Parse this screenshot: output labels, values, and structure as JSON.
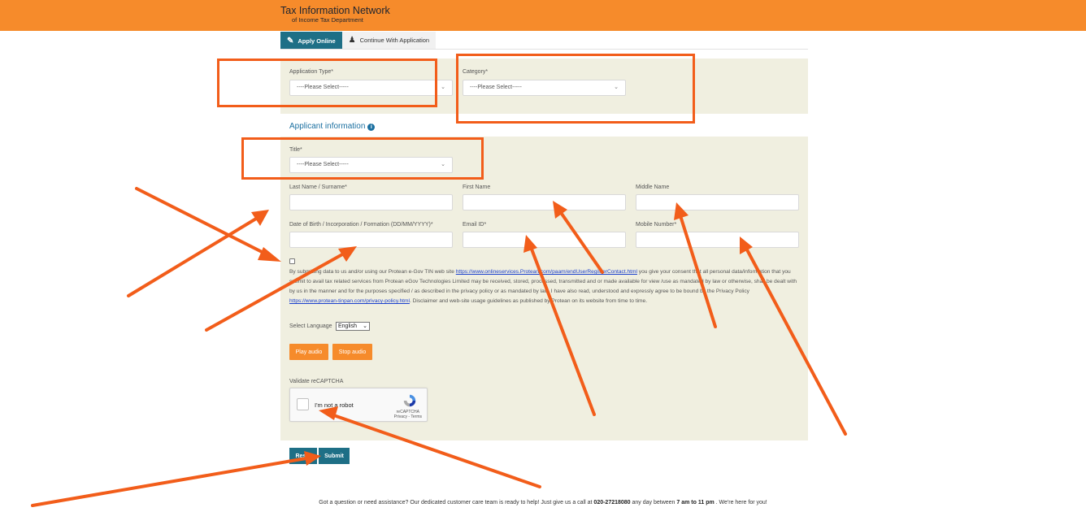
{
  "header": {
    "title": "Tax Information Network",
    "subtitle": "of Income Tax Department",
    "bg_color": "#f68b2b"
  },
  "tabs": [
    {
      "label": "Apply Online",
      "icon": "user-edit-icon",
      "active": true
    },
    {
      "label": "Continue With Application",
      "icon": "users-icon",
      "active": false
    }
  ],
  "application": {
    "type_label": "Application Type*",
    "type_value": "----Please Select-----",
    "category_label": "Category*",
    "category_value": "----Please Select-----"
  },
  "applicant": {
    "section_title": "Applicant information",
    "title_label": "Title*",
    "title_value": "----Please Select-----",
    "last_name_label": "Last Name / Surname*",
    "first_name_label": "First Name",
    "middle_name_label": "Middle Name",
    "dob_label": "Date of Birth / Incorporation / Formation (DD/MM/YYYY)*",
    "email_label": "Email ID*",
    "mobile_label": "Mobile Number*"
  },
  "consent": {
    "part1": "By submitting data to us and/or using our Protean e-Gov TIN web site ",
    "link1": "https://www.onlineservices.Protean.com/paam/endUserRegisterContact.html",
    "part2": " you give your consent that all personal data/information that you submit to avail tax related services from Protean eGov Technologies Limited may be received, stored, processed, transmitted and or made available for view /use as mandated by law or otherwise, shall be dealt with by us in the manner and for the purposes specified / as described in the privacy policy or as mandated by law. I have also read, understood and expressly agree to be bound by the Privacy Policy ",
    "link2": "https://www.protean-tinpan.com/privacy-policy.html",
    "part3": ". Disclaimer and web-site usage guidelines as published by Protean on its website from time to time."
  },
  "language": {
    "label": "Select Language",
    "selected": "English"
  },
  "audio": {
    "play_label": "Play audio",
    "stop_label": "Stop audio"
  },
  "captcha": {
    "label": "Validate reCAPTCHA",
    "text": "I'm not a robot",
    "brand": "reCAPTCHA",
    "links": "Privacy - Terms"
  },
  "actions": {
    "reset_label": "Reset",
    "submit_label": "Submit"
  },
  "footer": {
    "part1": "Got a question or need assistance? Our dedicated customer care team is ready to help! Just give us a call at ",
    "phone": "020-27218080",
    "part2": " any day between ",
    "hours": "7 am to 11 pm",
    "part3": " . We're here for you!"
  },
  "annotation_color": "#f25d1a"
}
